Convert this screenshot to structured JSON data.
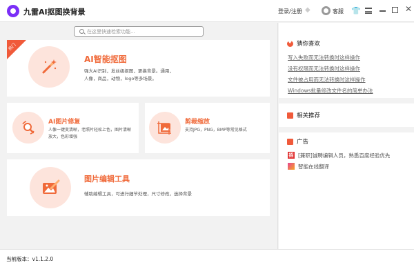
{
  "app": {
    "title": "九雷AI抠图换背景",
    "login_label": "登录/注册",
    "service_label": "客服"
  },
  "search": {
    "placeholder": "在这里快速检索功能..."
  },
  "cards": {
    "main": {
      "badge": "热门",
      "title": "AI智能抠图",
      "description": "强大AI识别，发丝级抠图，更换背景。通用，人像，商品，动物，logo等多场景。"
    },
    "repair": {
      "title": "AI图片修复",
      "description": "人像一键变清晰，老照片轻松上色，图片清晰放大，色彩增强"
    },
    "crop": {
      "title": "剪裁缩放",
      "description": "支持JPG，PNG，BMP等常见格式"
    },
    "edit": {
      "title": "图片编辑工具",
      "description": "辅助编辑工具，可进行细节处理，尺寸修改，选择背景"
    }
  },
  "sidebar": {
    "guess_title": "猜你喜欢",
    "guess_items": [
      "写入失败而无法转换时这样操作",
      "没有权限而无法转换时这样操作",
      "文件被占用而无法转换时这样操作",
      "Windows批量修改文件名的简单办法"
    ],
    "related_title": "相关推荐",
    "ads_title": "广告",
    "ads": [
      {
        "text": "[兼职]诚聘编辑人员，熟悉百度经验优先",
        "badge": "招"
      },
      {
        "text": "智能在线翻译",
        "badge": ""
      }
    ]
  },
  "status": {
    "version": "当前版本：v1.1.2.0"
  },
  "colors": {
    "accent": "#f06a3a",
    "circle_bg": "#fde4dc",
    "logo": "#7b2ff7"
  }
}
